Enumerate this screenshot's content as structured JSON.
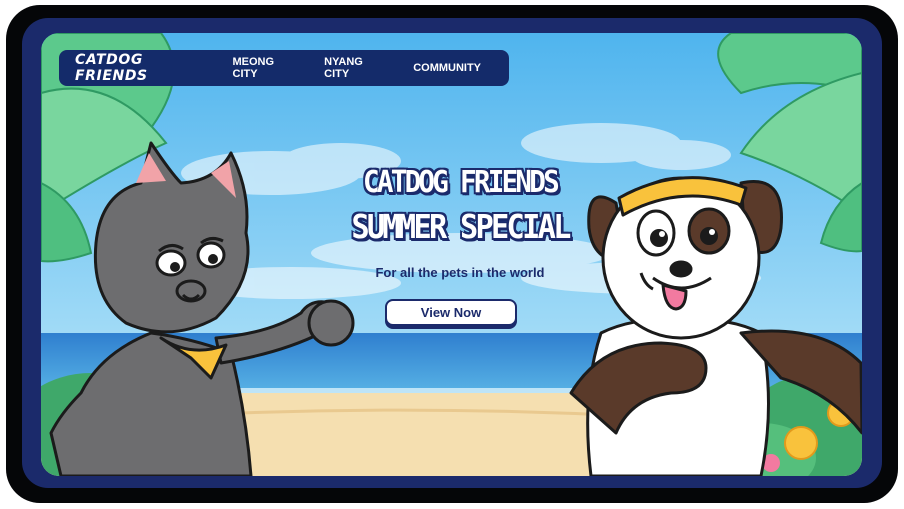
{
  "nav": {
    "brand": "CATDOG FRIENDS",
    "links": [
      "MEONG CITY",
      "NYANG CITY",
      "COMMUNITY"
    ]
  },
  "hero": {
    "title_line1": "CATDOG FRIENDS",
    "title_line2": "SUMMER SPECIAL",
    "subtitle": "For all the pets in the world",
    "cta_label": "View Now"
  },
  "colors": {
    "navy": "#1b2a6b",
    "sky": "#63c3f1",
    "sea": "#3a8fd6",
    "sand": "#f5dfb0",
    "accent_yellow": "#f9c23c",
    "cat_gray": "#6d6d6f",
    "dog_brown": "#5a3a2a"
  }
}
